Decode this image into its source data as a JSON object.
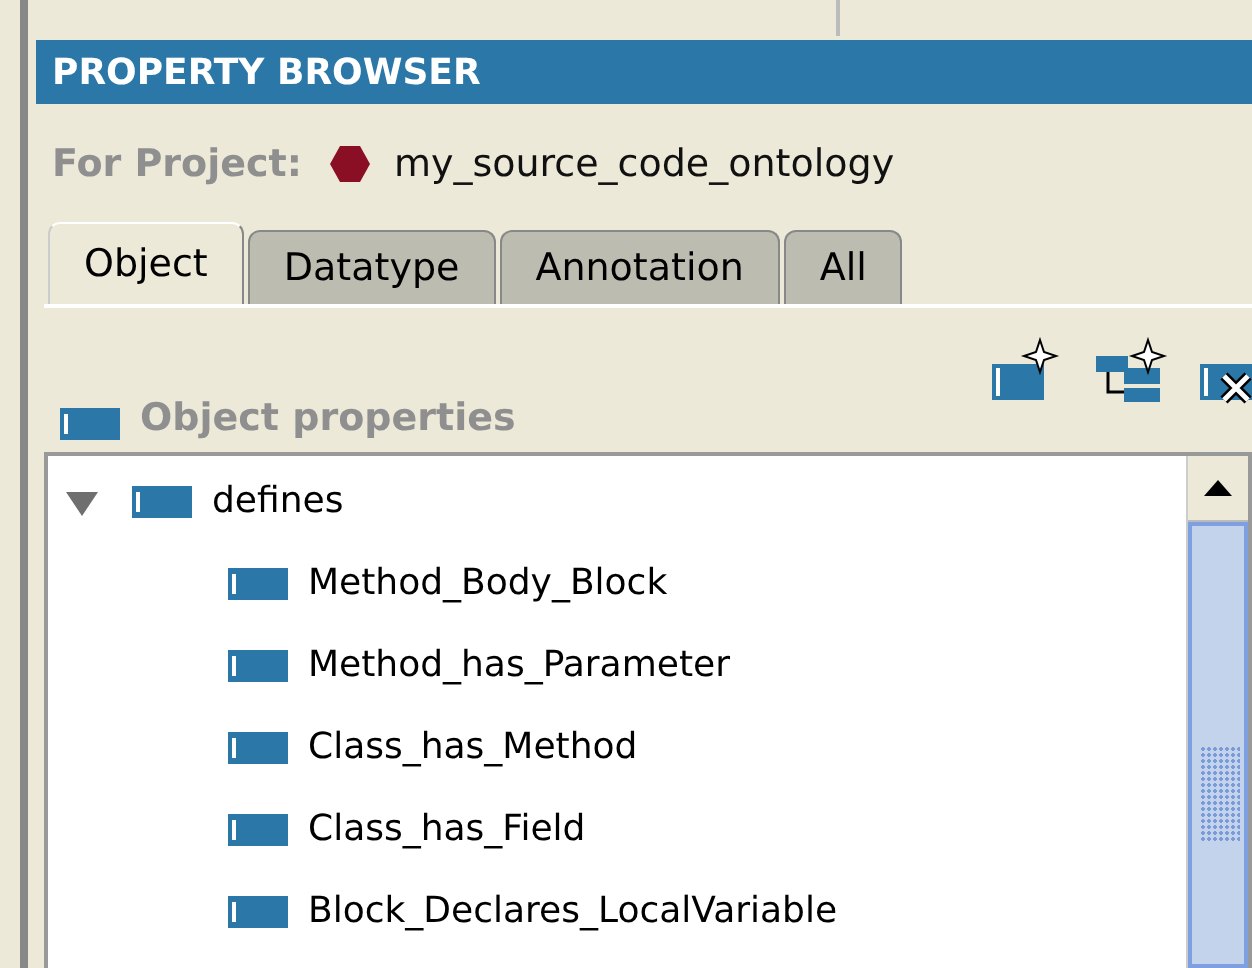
{
  "panel": {
    "title": "PROPERTY BROWSER"
  },
  "project": {
    "label": "For Project:",
    "name": "my_source_code_ontology"
  },
  "tabs": [
    {
      "label": "Object",
      "selected": true
    },
    {
      "label": "Datatype",
      "selected": false
    },
    {
      "label": "Annotation",
      "selected": false
    },
    {
      "label": "All",
      "selected": false
    }
  ],
  "section": {
    "title": "Object properties"
  },
  "tree": [
    {
      "label": "defines",
      "expanded": true,
      "children": [
        {
          "label": "Method_Body_Block"
        },
        {
          "label": "Method_has_Parameter"
        },
        {
          "label": "Class_has_Method"
        },
        {
          "label": "Class_has_Field"
        },
        {
          "label": "Block_Declares_LocalVariable"
        }
      ]
    }
  ]
}
